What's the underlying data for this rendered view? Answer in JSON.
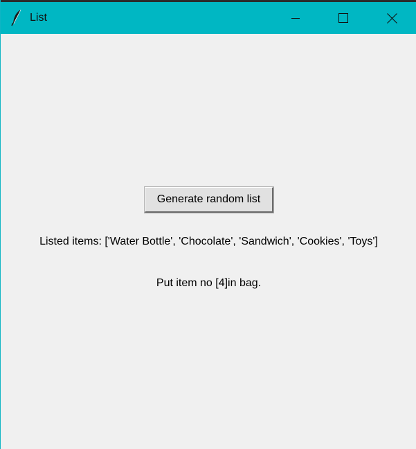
{
  "window": {
    "title": "List",
    "icon": "feather-icon",
    "accent_color": "#00b7c3"
  },
  "controls": {
    "minimize_icon": "minimize-icon",
    "maximize_icon": "maximize-icon",
    "close_icon": "close-icon"
  },
  "main": {
    "generate_button_label": "Generate random list",
    "listed_items_text": "Listed items: ['Water Bottle', 'Chocolate', 'Sandwich', 'Cookies', 'Toys']",
    "instruction_text": "Put item no [4]in bag."
  }
}
